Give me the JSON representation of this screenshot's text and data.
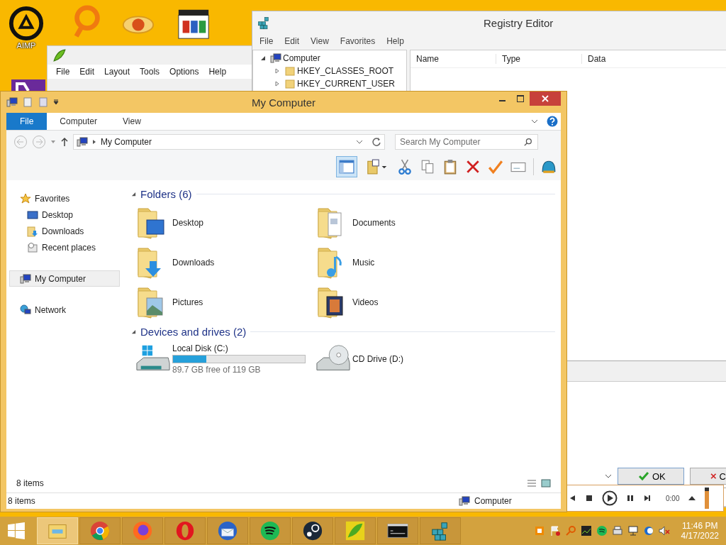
{
  "desktop": {
    "shortcut_label": "AIMP"
  },
  "peazip_window": {
    "menu": [
      "File",
      "Edit",
      "Layout",
      "Tools",
      "Options",
      "Help"
    ]
  },
  "registry_editor": {
    "title": "Registry Editor",
    "menu": [
      "File",
      "Edit",
      "View",
      "Favorites",
      "Help"
    ],
    "tree": [
      {
        "label": "Computer",
        "expanded": true,
        "children": [
          {
            "label": "HKEY_CLASSES_ROOT",
            "expanded": false
          },
          {
            "label": "HKEY_CURRENT_USER",
            "expanded": false
          }
        ]
      }
    ],
    "columns": [
      "Name",
      "Type",
      "Data"
    ]
  },
  "dialog": {
    "buttons": [
      {
        "label": "OK",
        "kind": "ok"
      },
      {
        "label": "C",
        "kind": "cancel"
      }
    ]
  },
  "media_player": {
    "time": "0:00",
    "level": 0.85
  },
  "explorer": {
    "title": "My Computer",
    "ribbon_tabs": [
      {
        "label": "File",
        "selected": true
      },
      {
        "label": "Computer",
        "selected": false
      },
      {
        "label": "View",
        "selected": false
      }
    ],
    "address": {
      "path": "My Computer"
    },
    "search": {
      "placeholder": "Search My Computer"
    },
    "nav": [
      {
        "label": "Favorites",
        "kind": "star",
        "selected": false,
        "children": [
          {
            "label": "Desktop",
            "kind": "desktop",
            "selected": false
          },
          {
            "label": "Downloads",
            "kind": "downloads",
            "selected": false
          },
          {
            "label": "Recent places",
            "kind": "recent",
            "selected": false
          }
        ]
      },
      {
        "label": "My Computer",
        "kind": "computer",
        "selected": true
      },
      {
        "label": "Network",
        "kind": "network",
        "selected": false
      }
    ],
    "folders_heading": "Folders (6)",
    "folders": [
      {
        "name": "Desktop",
        "kind": "desktop"
      },
      {
        "name": "Documents",
        "kind": "documents"
      },
      {
        "name": "Downloads",
        "kind": "downloads"
      },
      {
        "name": "Music",
        "kind": "music"
      },
      {
        "name": "Pictures",
        "kind": "pictures"
      },
      {
        "name": "Videos",
        "kind": "videos"
      }
    ],
    "drives_heading": "Devices and drives (2)",
    "drives": [
      {
        "name": "Local Disk (C:)",
        "kind": "disk",
        "level": 0.25,
        "free": "89.7 GB free of 119 GB"
      },
      {
        "name": "CD Drive (D:)",
        "kind": "cd"
      }
    ],
    "item_count": "8 items",
    "status_bar": {
      "items": "8 items",
      "location": "Computer"
    }
  },
  "taskbar": {
    "apps": [
      {
        "kind": "explorer",
        "selected": true
      },
      {
        "kind": "chrome",
        "selected": false
      },
      {
        "kind": "firefox",
        "selected": false
      },
      {
        "kind": "opera",
        "selected": false
      },
      {
        "kind": "thunderbird",
        "selected": false
      },
      {
        "kind": "spotify",
        "selected": false
      },
      {
        "kind": "steam",
        "selected": false
      },
      {
        "kind": "peazip",
        "selected": false
      },
      {
        "kind": "console",
        "selected": false
      },
      {
        "kind": "registry",
        "selected": false
      }
    ],
    "time": "11:46 PM",
    "date": "4/17/2022"
  }
}
